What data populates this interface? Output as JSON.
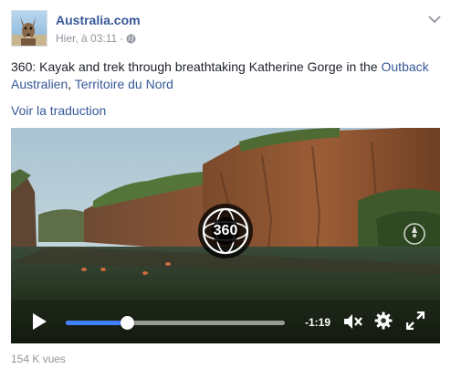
{
  "post": {
    "author": "Australia.com",
    "timestamp": "Hier, à 03:11",
    "separator": "·",
    "privacy_icon": "globe-icon",
    "options_icon": "chevron-down-icon",
    "text_main": "360: Kayak and trek through breathtaking Katherine Gorge in the ",
    "link_place": "Outback Australien",
    "text_sep": ", ",
    "link_region": "Territoire du Nord",
    "translate_label": "Voir la traduction"
  },
  "video": {
    "badge_label": "360",
    "time_remaining": "-1:19",
    "progress": 0.28,
    "icons": {
      "play": "play-icon",
      "mute": "volume-muted-icon",
      "settings": "gear-icon",
      "fullscreen": "fullscreen-icon",
      "compass": "compass-icon"
    }
  },
  "footer": {
    "views": "154 K vues"
  },
  "colors": {
    "link": "#365899",
    "meta": "#90949c",
    "progress_fill": "#4080ff"
  }
}
